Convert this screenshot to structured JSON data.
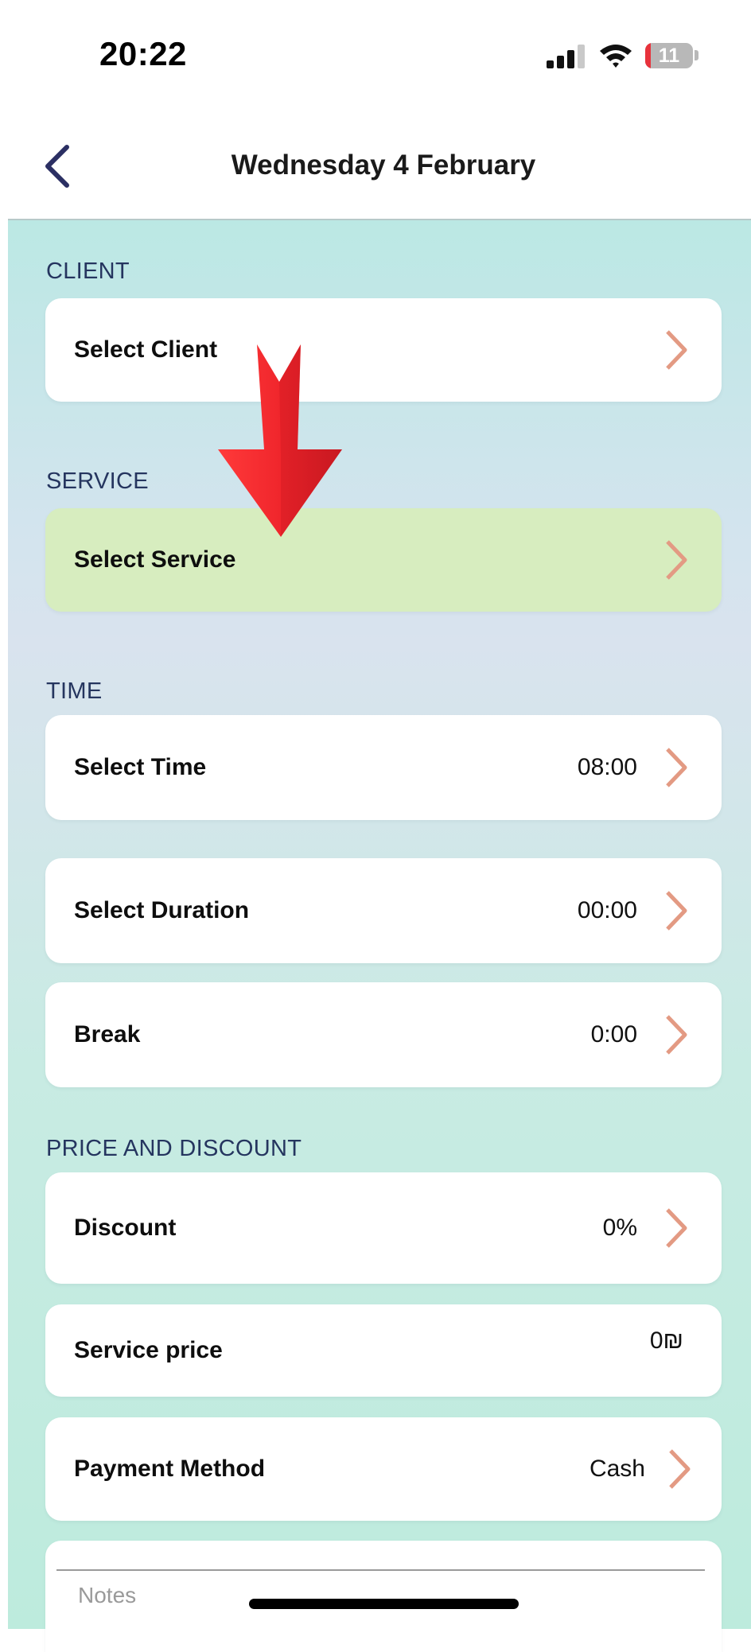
{
  "status_bar": {
    "time": "20:22",
    "battery_level": "11",
    "battery_fraction": 0.11,
    "icons": [
      "signal-icon",
      "wifi-icon",
      "battery-icon"
    ]
  },
  "header": {
    "title": "Wednesday 4 February",
    "back_icon": "chevron-left-icon"
  },
  "sections": {
    "client": {
      "label": "CLIENT",
      "row_label": "Select Client"
    },
    "service": {
      "label": "SERVICE",
      "row_label": "Select Service"
    },
    "time": {
      "label": "TIME",
      "time_label": "Select Time",
      "time_value": "08:00",
      "duration_label": "Select Duration",
      "duration_value": "00:00",
      "break_label": "Break",
      "break_value": "0:00"
    },
    "price": {
      "label": "PRICE AND DISCOUNT",
      "discount_label": "Discount",
      "discount_value": "0%",
      "price_label": "Service price",
      "price_value": "0₪",
      "payment_label": "Payment Method",
      "payment_value": "Cash"
    },
    "notes": {
      "placeholder": "Notes"
    }
  },
  "colors": {
    "accent_chevron": "#e39a83",
    "highlight_row": "#d7edbf",
    "section_label": "#25355f",
    "annotation_arrow": "#e8262f"
  }
}
